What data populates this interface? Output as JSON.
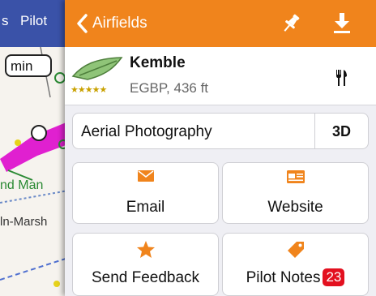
{
  "map": {
    "tab_s": "s",
    "tab_pilot": "Pilot",
    "min_label": "min",
    "label_green": "nd Man",
    "label_dark": "ln-Marsh"
  },
  "header": {
    "back_label": "Airfields",
    "background_color": "#f0841c",
    "icons": [
      "chevron-left-icon",
      "pin-icon",
      "download-icon"
    ]
  },
  "airfield": {
    "name": "Kemble",
    "rating_stars": "★★★★★",
    "info": "EGBP, 436 ft",
    "facility_icon": "utensils-icon"
  },
  "aerial": {
    "label": "Aerial Photography",
    "mode_3d": "3D"
  },
  "actions": {
    "email": {
      "label": "Email",
      "icon": "envelope-icon"
    },
    "website": {
      "label": "Website",
      "icon": "browser-window-icon"
    },
    "feedback": {
      "label": "Send Feedback",
      "icon": "star-icon"
    },
    "notes": {
      "label": "Pilot Notes",
      "icon": "tag-icon",
      "count": "23"
    }
  },
  "colors": {
    "accent": "#f0841c",
    "badge": "#e3101f",
    "map_bar": "#3a52a8",
    "route": "#e020d0"
  }
}
